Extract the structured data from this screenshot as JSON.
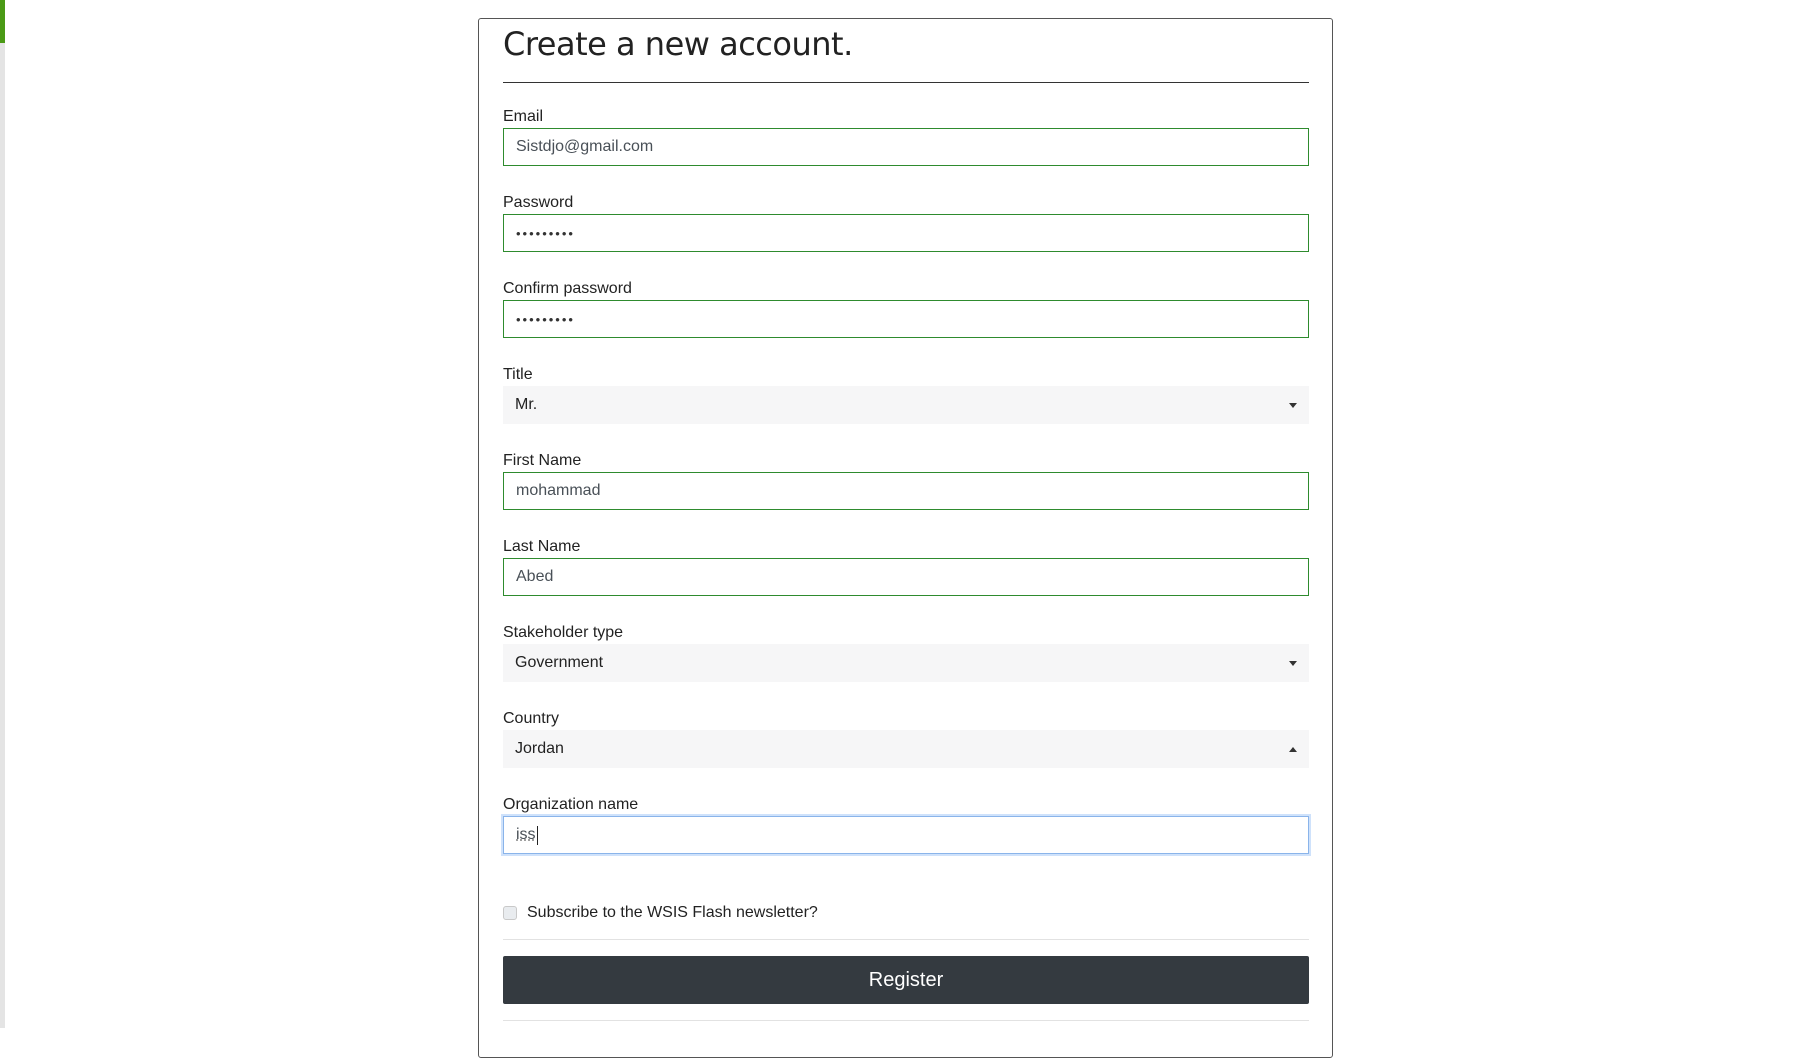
{
  "form": {
    "title": "Create a new account.",
    "email": {
      "label": "Email",
      "value": "Sistdjo@gmail.com"
    },
    "password": {
      "label": "Password",
      "value": "•••••••••"
    },
    "confirm_password": {
      "label": "Confirm password",
      "value": "•••••••••"
    },
    "title_select": {
      "label": "Title",
      "value": "Mr."
    },
    "first_name": {
      "label": "First Name",
      "value": "mohammad"
    },
    "last_name": {
      "label": "Last Name",
      "value": "Abed"
    },
    "stakeholder_type": {
      "label": "Stakeholder type",
      "value": "Government"
    },
    "country": {
      "label": "Country",
      "value": "Jordan"
    },
    "organization": {
      "label": "Organization name",
      "value": "iss"
    },
    "newsletter": {
      "label": "Subscribe to the WSIS Flash newsletter?",
      "checked": false
    },
    "register_label": "Register"
  },
  "colors": {
    "valid_border": "#2e8b2e",
    "focus_border": "#8ab4ea",
    "button_bg": "#343a40",
    "accent": "#4a9a15"
  },
  "icons": {
    "select_arrow": "caret-down-icon",
    "select_open_arrow": "caret-up-icon"
  }
}
